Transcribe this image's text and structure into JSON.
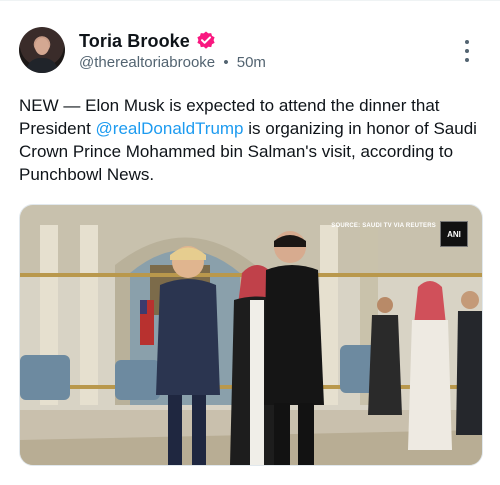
{
  "post": {
    "author": {
      "display_name": "Toria Brooke",
      "handle": "@therealtoriabrooke",
      "separator": "•",
      "time": "50m",
      "verified_color": "#f91880"
    },
    "text_before": "NEW — Elon Musk is expected to attend the dinner that President ",
    "mention": "@realDonaldTrump",
    "text_after": " is organizing in honor of Saudi Crown Prince Mohammed bin Salman's visit, according to Punchbowl News.",
    "media": {
      "caption": "SOURCE: SAUDI TV VIA REUTERS",
      "logo_text": "ANI"
    }
  },
  "colors": {
    "text": "#0f1419",
    "secondary": "#536471",
    "link": "#1d9bf0"
  },
  "icons": {
    "verified": "verified-badge-icon",
    "more": "more-vertical-icon"
  }
}
